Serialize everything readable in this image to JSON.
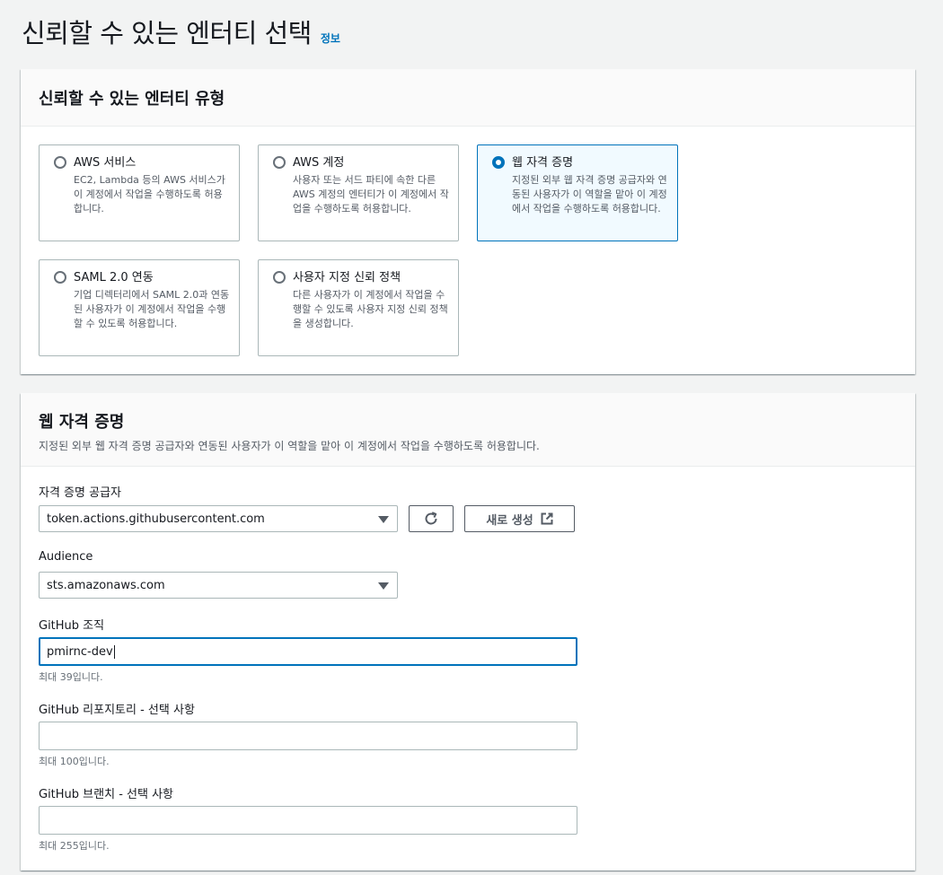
{
  "page": {
    "title": "신뢰할 수 있는 엔터티 선택",
    "info_link": "정보"
  },
  "entity_type": {
    "title": "신뢰할 수 있는 엔터티 유형",
    "options": [
      {
        "title": "AWS 서비스",
        "desc": "EC2, Lambda 등의 AWS 서비스가 이 계정에서 작업을 수행하도록 허용합니다.",
        "selected": false
      },
      {
        "title": "AWS 계정",
        "desc": "사용자 또는 서드 파티에 속한 다른 AWS 계정의 엔터티가 이 계정에서 작업을 수행하도록 허용합니다.",
        "selected": false
      },
      {
        "title": "웹 자격 증명",
        "desc": "지정된 외부 웹 자격 증명 공급자와 연동된 사용자가 이 역할을 맡아 이 계정에서 작업을 수행하도록 허용합니다.",
        "selected": true
      },
      {
        "title": "SAML 2.0 연동",
        "desc": "기업 디렉터리에서 SAML 2.0과 연동된 사용자가 이 계정에서 작업을 수행할 수 있도록 허용합니다.",
        "selected": false
      },
      {
        "title": "사용자 지정 신뢰 정책",
        "desc": "다른 사용자가 이 계정에서 작업을 수행할 수 있도록 사용자 지정 신뢰 정책을 생성합니다.",
        "selected": false
      }
    ]
  },
  "web_identity": {
    "title": "웹 자격 증명",
    "description": "지정된 외부 웹 자격 증명 공급자와 연동된 사용자가 이 역할을 맡아 이 계정에서 작업을 수행하도록 허용합니다.",
    "provider": {
      "label": "자격 증명 공급자",
      "value": "token.actions.githubusercontent.com",
      "create_button": "새로 생성"
    },
    "audience": {
      "label": "Audience",
      "value": "sts.amazonaws.com"
    },
    "github_org": {
      "label": "GitHub 조직",
      "value": "pmirnc-dev",
      "hint": "최대 39입니다."
    },
    "github_repo": {
      "label": "GitHub 리포지토리 - 선택 사항",
      "value": "",
      "hint": "최대 100입니다."
    },
    "github_branch": {
      "label": "GitHub 브랜치 - 선택 사항",
      "value": "",
      "hint": "최대 255입니다."
    }
  },
  "colors": {
    "accent": "#0073bb",
    "background": "#f2f3f3"
  },
  "icons": {
    "refresh": "refresh-icon",
    "external": "external-link-icon",
    "caret": "caret-down-icon"
  }
}
